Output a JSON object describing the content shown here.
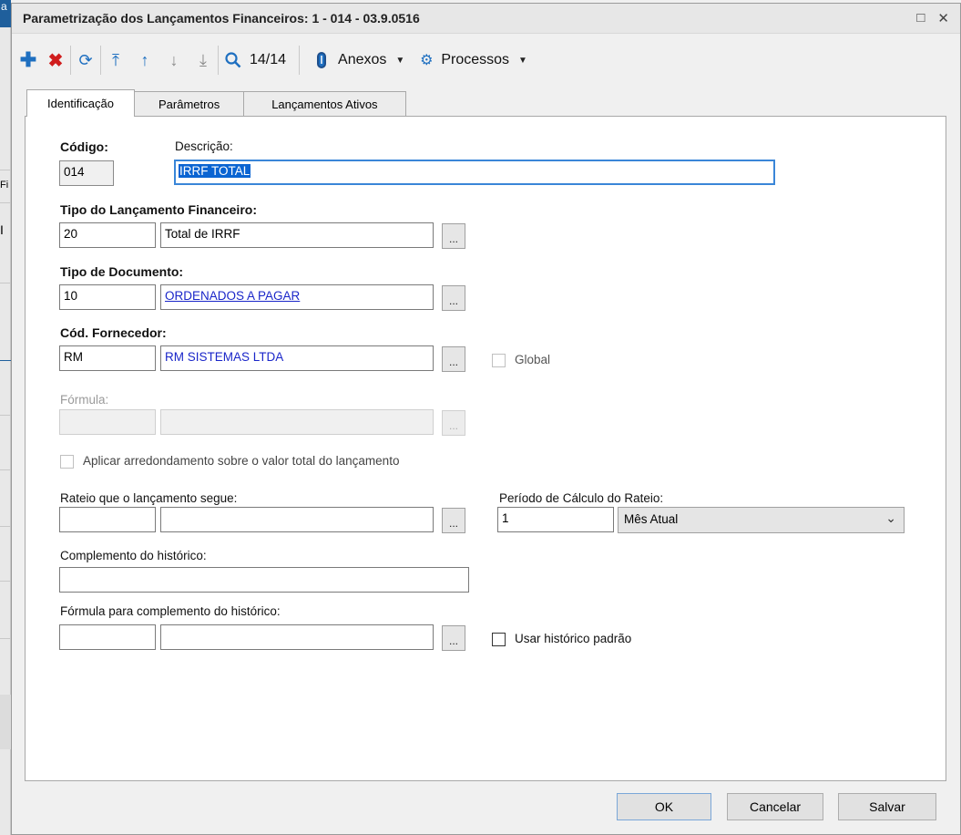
{
  "window": {
    "title": "Parametrização dos Lançamentos Financeiros: 1 - 014 - 03.9.0516"
  },
  "background": {
    "tab_label": "a",
    "left_fragments": [
      "Fi",
      "I"
    ]
  },
  "toolbar": {
    "counter": "14/14",
    "anexos_label": "Anexos",
    "processos_label": "Processos"
  },
  "tabs": [
    {
      "label": "Identificação",
      "active": true
    },
    {
      "label": "Parâmetros",
      "active": false
    },
    {
      "label": "Lançamentos Ativos",
      "active": false
    }
  ],
  "form": {
    "codigo_label": "Código:",
    "codigo_value": "014",
    "descricao_label": "Descrição:",
    "descricao_value": "IRRF TOTAL",
    "tipo_lanc_label": "Tipo do Lançamento Financeiro:",
    "tipo_lanc_code": "20",
    "tipo_lanc_desc": "Total de IRRF",
    "tipo_doc_label": "Tipo de Documento:",
    "tipo_doc_code": "10",
    "tipo_doc_desc": "ORDENADOS A PAGAR",
    "fornecedor_label": "Cód. Fornecedor:",
    "fornecedor_code": "RM",
    "fornecedor_desc": "RM SISTEMAS LTDA",
    "global_label": "Global",
    "formula_label": "Fórmula:",
    "formula_code": "",
    "formula_desc": "",
    "arredondamento_label": "Aplicar arredondamento sobre o valor total do lançamento",
    "rateio_label": "Rateio que o lançamento segue:",
    "rateio_code": "",
    "rateio_desc": "",
    "periodo_label": "Período de Cálculo do Rateio:",
    "periodo_value": "1",
    "periodo_option": "Mês Atual",
    "complemento_label": "Complemento do histórico:",
    "complemento_value": "",
    "formula_compl_label": "Fórmula para complemento do histórico:",
    "formula_compl_code": "",
    "formula_compl_desc": "",
    "usar_hist_label": "Usar histórico padrão",
    "dots": "..."
  },
  "footer": {
    "ok": "OK",
    "cancelar": "Cancelar",
    "salvar": "Salvar"
  },
  "colors": {
    "link": "#1a26c9",
    "selection": "#0a64d2",
    "add": "#1e6fc0",
    "delete": "#d01d1d"
  }
}
